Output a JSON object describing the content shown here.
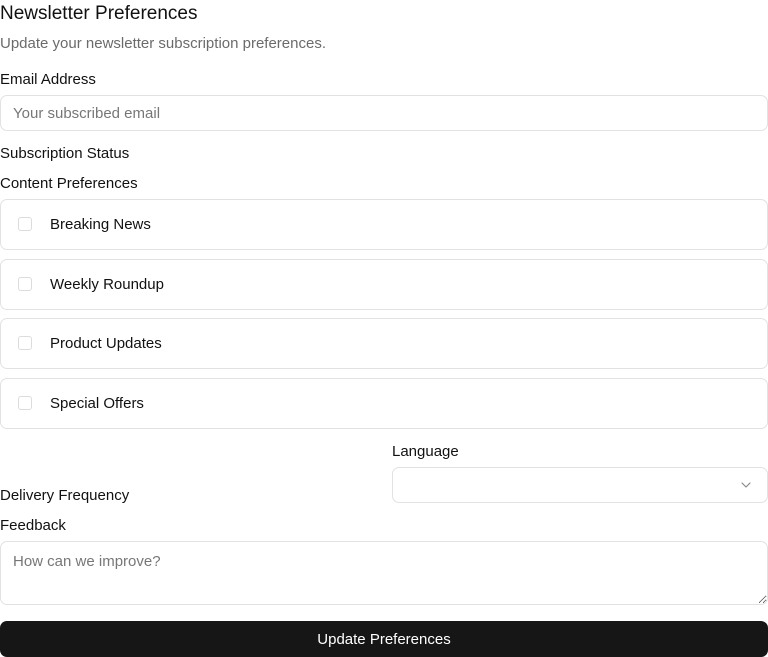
{
  "header": {
    "title": "Newsletter Preferences",
    "subtitle": "Update your newsletter subscription preferences."
  },
  "email": {
    "label": "Email Address",
    "placeholder": "Your subscribed email",
    "value": ""
  },
  "subscription_status": {
    "label": "Subscription Status"
  },
  "content_preferences": {
    "label": "Content Preferences",
    "options": [
      {
        "label": "Breaking News",
        "checked": false
      },
      {
        "label": "Weekly Roundup",
        "checked": false
      },
      {
        "label": "Product Updates",
        "checked": false
      },
      {
        "label": "Special Offers",
        "checked": false
      }
    ]
  },
  "delivery_frequency": {
    "label": "Delivery Frequency"
  },
  "language": {
    "label": "Language",
    "selected": "",
    "icon": "chevron-down-icon"
  },
  "feedback": {
    "label": "Feedback",
    "placeholder": "How can we improve?",
    "value": ""
  },
  "submit": {
    "label": "Update Preferences"
  },
  "colors": {
    "button_bg": "#161616",
    "button_text": "#ffffff",
    "border": "#e2e2e2",
    "muted_text": "#6b6b6b"
  }
}
